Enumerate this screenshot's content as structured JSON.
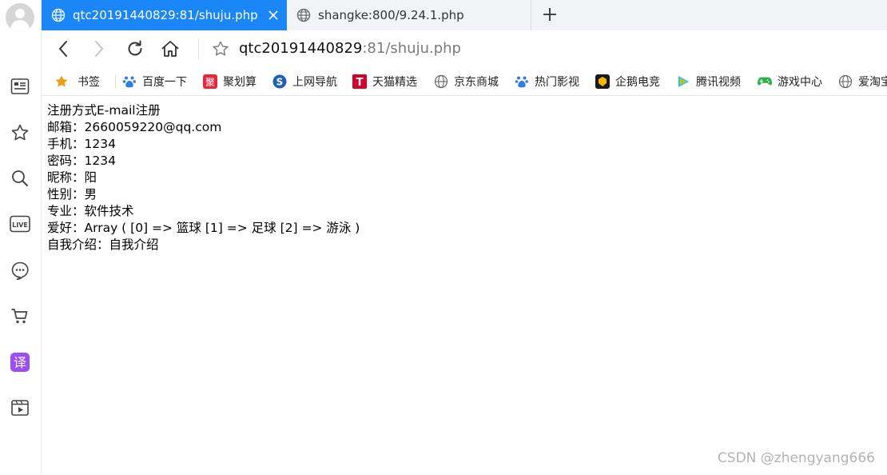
{
  "tabs": [
    {
      "title": "qtc20191440829:81/shuju.php",
      "active": true
    },
    {
      "title": "shangke:800/9.24.1.php",
      "active": false
    }
  ],
  "address": {
    "host": "qtc20191440829",
    "rest": ":81/shuju.php"
  },
  "bookmarks": [
    {
      "label": "书签",
      "icon": "star-icon"
    },
    {
      "label": "百度一下",
      "icon": "baidu-paw-icon"
    },
    {
      "label": "聚划算",
      "icon": "juhuasuan-icon"
    },
    {
      "label": "上网导航",
      "icon": "sogou-icon"
    },
    {
      "label": "天猫精选",
      "icon": "tmall-icon"
    },
    {
      "label": "京东商城",
      "icon": "globe-icon"
    },
    {
      "label": "热门影视",
      "icon": "baidu-paw-icon"
    },
    {
      "label": "企鹅电竞",
      "icon": "penguin-esports-icon"
    },
    {
      "label": "腾讯视频",
      "icon": "tencent-video-icon"
    },
    {
      "label": "游戏中心",
      "icon": "gamepad-icon"
    },
    {
      "label": "爱淘宝",
      "icon": "globe-icon"
    }
  ],
  "content": {
    "lines": [
      "注册方式E-mail注册",
      "邮箱：2660059220@qq.com",
      "手机：1234",
      "密码：1234",
      "昵称：阳",
      "性别：男",
      "专业：软件技术",
      "爱好：Array ( [0] => 篮球 [1] => 足球 [2] => 游泳 )",
      "自我介绍：自我介绍"
    ]
  },
  "watermark": "CSDN @zhengyang666",
  "colors": {
    "tab_active": "#1a86f8",
    "tab_strip": "#f1f3f6"
  }
}
